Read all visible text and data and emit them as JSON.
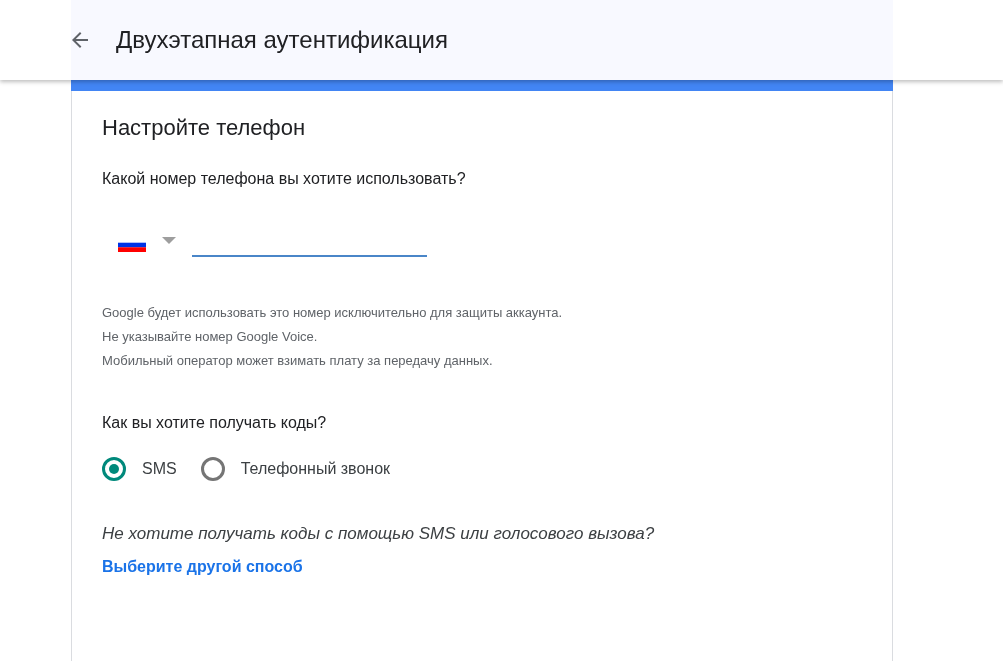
{
  "header": {
    "title": "Двухэтапная аутентификация"
  },
  "section": {
    "title": "Настройте телефон",
    "phone_question": "Какой номер телефона вы хотите использовать?",
    "notes": [
      "Google будет использовать это номер исключительно для защиты аккаунта.",
      "Не указывайте номер Google Voice.",
      "Мобильный оператор может взимать плату за передачу данных."
    ],
    "codes_question": "Как вы хотите получать коды?",
    "methods": [
      {
        "label": "SMS",
        "selected": true
      },
      {
        "label": "Телефонный звонок",
        "selected": false
      }
    ],
    "alternative_question": "Не хотите получать коды с помощью SMS или голосового вызова?",
    "alternative_link": "Выберите другой способ"
  }
}
